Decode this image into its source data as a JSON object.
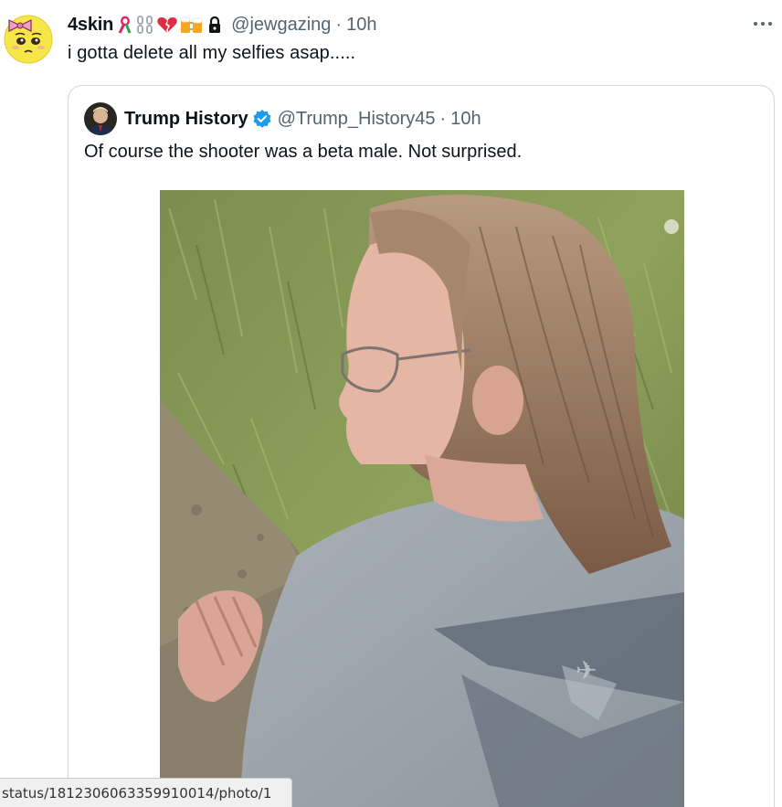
{
  "tweet": {
    "display_name": "4skin",
    "emojis": [
      "ribbon-icon",
      "chain-icon",
      "broken-heart-icon",
      "beer-mugs-icon"
    ],
    "lock_icon": "lock-icon",
    "handle": "@jewgazing",
    "separator": "·",
    "time": "10h",
    "text": "i gotta delete all my selfies asap.....",
    "more_icon": "more-horizontal-icon"
  },
  "quote": {
    "display_name": "Trump History",
    "verified_icon": "verified-badge-icon",
    "verified_color": "#1d9bf0",
    "handle": "@Trump_History45",
    "separator": "·",
    "time": "10h",
    "text": "Of course the shooter was a beta male. Not surprised."
  },
  "status_bar": {
    "url": "status/1812306063359910014/photo/1"
  },
  "colors": {
    "text": "#0f1419",
    "secondary": "#536471",
    "border": "#cfd9de",
    "accent": "#1d9bf0"
  }
}
